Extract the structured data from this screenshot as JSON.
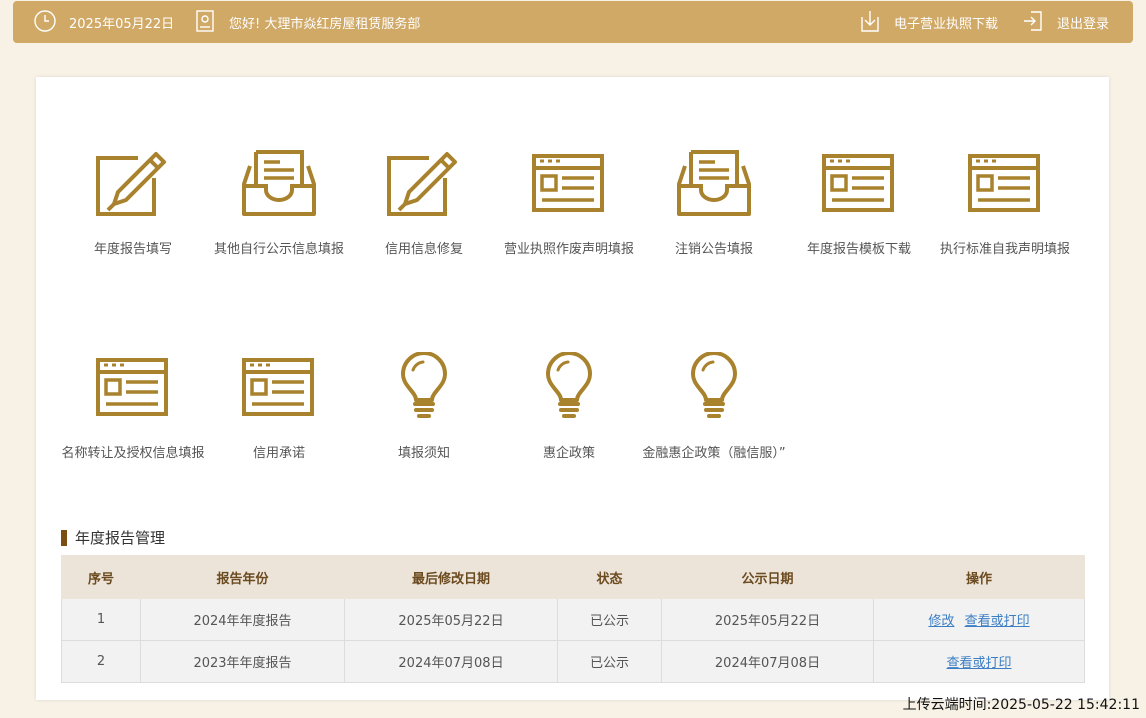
{
  "header": {
    "date": "2025年05月22日",
    "greeting": "您好!  大理市焱红房屋租赁服务部",
    "download_label": "电子营业执照下载",
    "logout_label": "退出登录"
  },
  "tiles_row1": [
    {
      "label": "年度报告填写",
      "icon": "pencil-doc-icon"
    },
    {
      "label": "其他自行公示信息填报",
      "icon": "inbox-doc-icon"
    },
    {
      "label": "信用信息修复",
      "icon": "pencil-doc-icon"
    },
    {
      "label": "营业执照作废声明填报",
      "icon": "browser-form-icon"
    },
    {
      "label": "注销公告填报",
      "icon": "inbox-doc-icon"
    },
    {
      "label": "年度报告模板下载",
      "icon": "browser-form-icon"
    },
    {
      "label": "执行标准自我声明填报",
      "icon": "browser-form-icon"
    }
  ],
  "tiles_row2": [
    {
      "label": "名称转让及授权信息填报",
      "icon": "browser-form-icon"
    },
    {
      "label": "信用承诺",
      "icon": "browser-form-icon"
    },
    {
      "label": "填报须知",
      "icon": "lightbulb-icon"
    },
    {
      "label": "惠企政策",
      "icon": "lightbulb-icon"
    },
    {
      "label": "金融惠企政策（融信服）”",
      "icon": "lightbulb-icon"
    }
  ],
  "section": {
    "title": "年度报告管理"
  },
  "table": {
    "columns": [
      "序号",
      "报告年份",
      "最后修改日期",
      "状态",
      "公示日期",
      "操作"
    ],
    "rows": [
      {
        "no": "1",
        "year": "2024年年度报告",
        "modified": "2025年05月22日",
        "status": "已公示",
        "published": "2025年05月22日",
        "actions": [
          "修改",
          "查看或打印"
        ]
      },
      {
        "no": "2",
        "year": "2023年年度报告",
        "modified": "2024年07月08日",
        "status": "已公示",
        "published": "2024年07月08日",
        "actions": [
          "查看或打印"
        ]
      }
    ]
  },
  "footer": {
    "upload_time": "上传云端时间:2025-05-22 15:42:11"
  },
  "colors": {
    "accent": "#d0a966",
    "icon": "#a8822c",
    "link": "#3c7ec4"
  }
}
